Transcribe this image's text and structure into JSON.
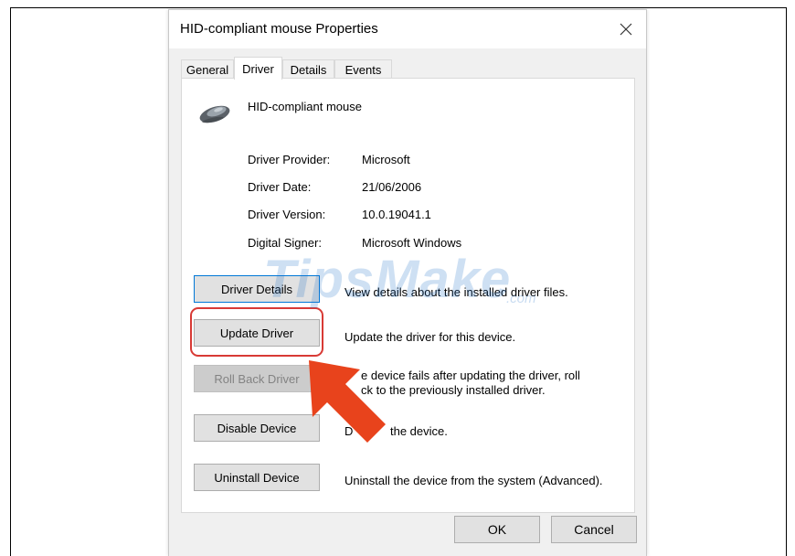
{
  "dialog": {
    "title": "HID-compliant mouse Properties",
    "close_icon": "close-icon"
  },
  "tabs": [
    {
      "label": "General",
      "active": false
    },
    {
      "label": "Driver",
      "active": true
    },
    {
      "label": "Details",
      "active": false
    },
    {
      "label": "Events",
      "active": false
    }
  ],
  "device": {
    "icon": "mouse-icon",
    "name": "HID-compliant mouse"
  },
  "driver_info": [
    {
      "label": "Driver Provider:",
      "value": "Microsoft"
    },
    {
      "label": "Driver Date:",
      "value": "21/06/2006"
    },
    {
      "label": "Driver Version:",
      "value": "10.0.19041.1"
    },
    {
      "label": "Digital Signer:",
      "value": "Microsoft Windows"
    }
  ],
  "actions": [
    {
      "label": "Driver Details",
      "description": "View details about the installed driver files.",
      "enabled": true
    },
    {
      "label": "Update Driver",
      "description": "Update the driver for this device.",
      "enabled": true
    },
    {
      "label": "Roll Back Driver",
      "description_line1": "e device fails after updating the driver, roll",
      "description_line2": "ck to the previously installed driver.",
      "enabled": false
    },
    {
      "label": "Disable Device",
      "description_prefix": "D",
      "description": "the device.",
      "enabled": true
    },
    {
      "label": "Uninstall Device",
      "description": "Uninstall the device from the system (Advanced).",
      "enabled": true
    }
  ],
  "footer": {
    "ok_label": "OK",
    "cancel_label": "Cancel"
  },
  "watermark": {
    "text": "TipsMake",
    "suffix": ".com"
  },
  "annotation": {
    "highlight_color": "#d83a35",
    "arrow_color": "#e8431c"
  }
}
